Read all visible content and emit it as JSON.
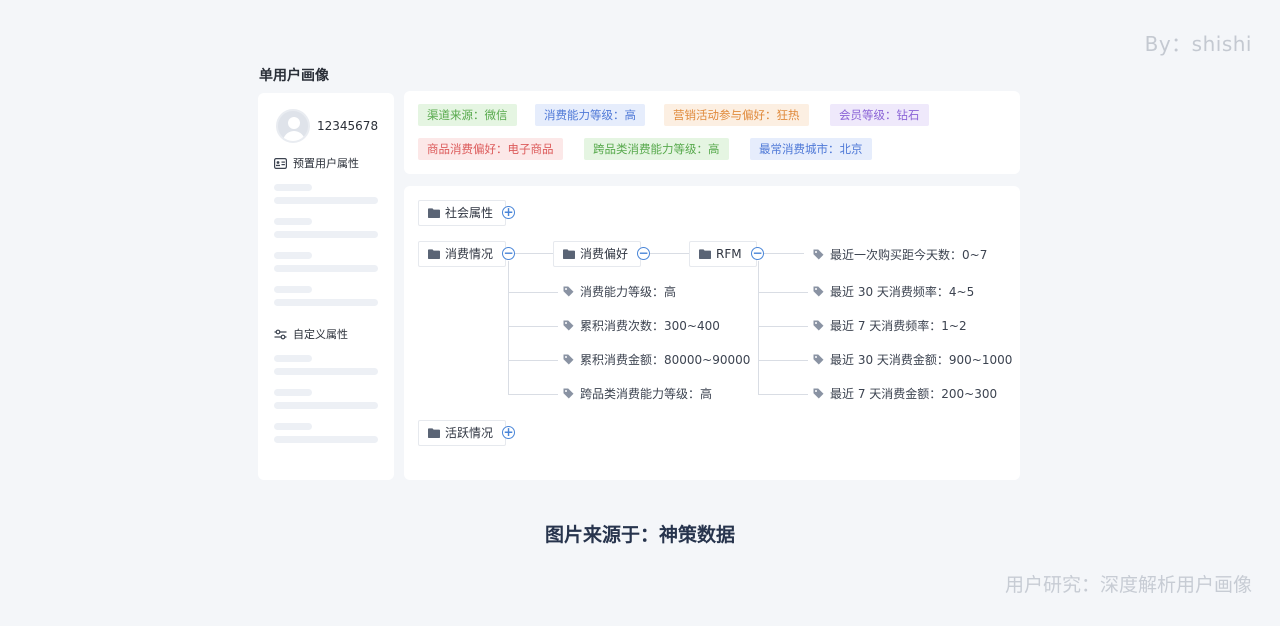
{
  "watermark_top": "By：shishi",
  "watermark_bottom": "用户研究：深度解析用户画像",
  "caption": "图片来源于：神策数据",
  "panel_title": "单用户画像",
  "user": {
    "id": "12345678"
  },
  "sections": {
    "preset": "预置用户属性",
    "custom": "自定义属性"
  },
  "tags": [
    {
      "label": "渠道来源：微信",
      "color": "green"
    },
    {
      "label": "消费能力等级：高",
      "color": "blue"
    },
    {
      "label": "营销活动参与偏好：狂热",
      "color": "orange"
    },
    {
      "label": "会员等级：钻石",
      "color": "purple"
    },
    {
      "label": "商品消费偏好：电子商品",
      "color": "red"
    },
    {
      "label": "跨品类消费能力等级：高",
      "color": "green"
    },
    {
      "label": "最常消费城市：北京",
      "color": "blue"
    }
  ],
  "tree": {
    "social": "社会属性",
    "consumption": "消费情况",
    "preference": "消费偏好",
    "rfm": "RFM",
    "activity": "活跃情况",
    "preference_leaves": [
      "消费能力等级：高",
      "累积消费次数：300~400",
      "累积消费金额：80000~90000",
      "跨品类消费能力等级：高"
    ],
    "rfm_leaves": [
      "最近一次购买距今天数：0~7",
      "最近 30 天消费频率：4~5",
      "最近 7 天消费频率：1~2",
      "最近 30 天消费金额：900~1000",
      "最近 7 天消费金额：200~300"
    ],
    "expand_symbol": "+",
    "collapse_symbol": "−"
  }
}
